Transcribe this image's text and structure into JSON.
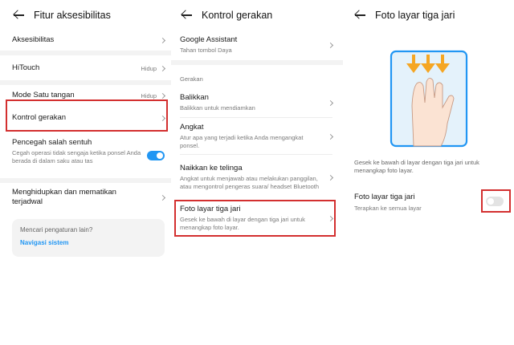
{
  "panel1": {
    "title": "Fitur aksesibilitas",
    "items": [
      {
        "label": "Aksesibilitas"
      },
      {
        "label": "HiTouch",
        "value": "Hidup"
      },
      {
        "label": "Mode Satu tangan",
        "value": "Hidup"
      },
      {
        "label": "Kontrol gerakan"
      },
      {
        "label": "Pencegah salah sentuh",
        "sub": "Cegah operasi tidak sengaja ketika ponsel Anda berada di dalam saku atau tas",
        "toggle": true
      },
      {
        "label": "Menghidupkan dan mematikan terjadwal"
      }
    ],
    "card": {
      "question": "Mencari pengaturan lain?",
      "link": "Navigasi sistem"
    }
  },
  "panel2": {
    "title": "Kontrol gerakan",
    "top": {
      "label": "Google Assistant",
      "sub": "Tahan tombol Daya"
    },
    "section": "Gerakan",
    "items": [
      {
        "label": "Balikkan",
        "sub": "Balikkan untuk mendiamkan"
      },
      {
        "label": "Angkat",
        "sub": "Atur apa yang terjadi ketika Anda mengangkat ponsel."
      },
      {
        "label": "Naikkan ke telinga",
        "sub": "Angkat untuk menjawab atau melakukan panggilan, atau mengontrol pengeras suara/ headset Bluetooth"
      },
      {
        "label": "Foto layar tiga jari",
        "sub": "Gesek ke bawah di layar dengan tiga jari untuk menangkap foto layar."
      }
    ]
  },
  "panel3": {
    "title": "Foto layar tiga jari",
    "description": "Gesek ke bawah di layar dengan tiga jari untuk menangkap foto layar.",
    "setting": {
      "label": "Foto layar tiga jari",
      "sub": "Terapkan ke semua layar",
      "toggle": false
    }
  },
  "colors": {
    "accent": "#2196f3",
    "highlight": "#d32f2f",
    "arrows": "#f5a623"
  }
}
